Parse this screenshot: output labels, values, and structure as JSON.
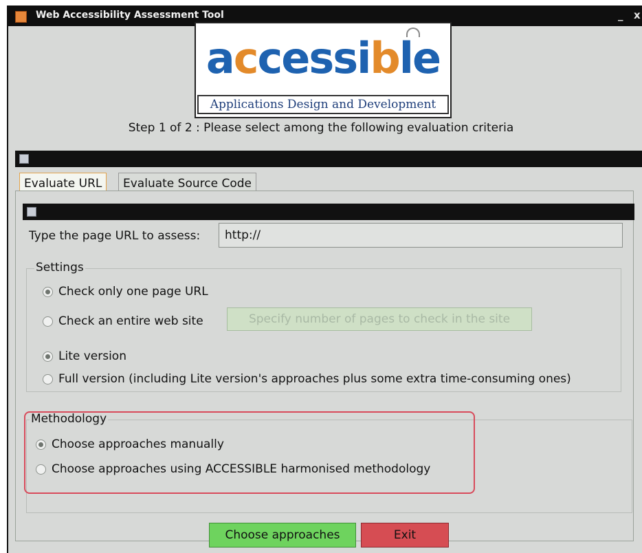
{
  "window": {
    "title": "Web Accessibility Assessment Tool",
    "minimize_glyph": "_",
    "close_glyph": "x",
    "app_icon": "java-app-icon"
  },
  "logo": {
    "word_part1": "a",
    "word_part2": "c",
    "word_part3": "cessi",
    "word_part4": "b",
    "word_part5": "le",
    "tagline": "Applications Design and Development",
    "colors": {
      "primary": "#1e62b0",
      "accent": "#e38a2a"
    }
  },
  "step_text": "Step 1 of 2 : Please select among the following evaluation criteria",
  "tabs": [
    {
      "label": "Evaluate URL",
      "active": true
    },
    {
      "label": "Evaluate Source Code",
      "active": false
    }
  ],
  "url": {
    "label": "Type the page URL to assess:",
    "value": "http://"
  },
  "settings": {
    "legend": "Settings",
    "options": [
      {
        "label": "Check only one page URL",
        "checked": true
      },
      {
        "label": "Check an entire web site",
        "checked": false
      }
    ],
    "pages_button": "Specify number of pages to check in the site",
    "versions": [
      {
        "label": "Lite version",
        "checked": true
      },
      {
        "label": "Full version (including Lite version's approaches plus some extra time-consuming ones)",
        "checked": false
      }
    ]
  },
  "methodology": {
    "legend": "Methodology",
    "options": [
      {
        "label": "Choose approaches manually",
        "checked": true
      },
      {
        "label": "Choose approaches using ACCESSIBLE harmonised methodology",
        "checked": false
      }
    ]
  },
  "buttons": {
    "choose": "Choose approaches",
    "exit": "Exit"
  },
  "colors": {
    "choose_button": "#6ed35e",
    "exit_button": "#d64d53",
    "highlight": "#d84a5a"
  }
}
